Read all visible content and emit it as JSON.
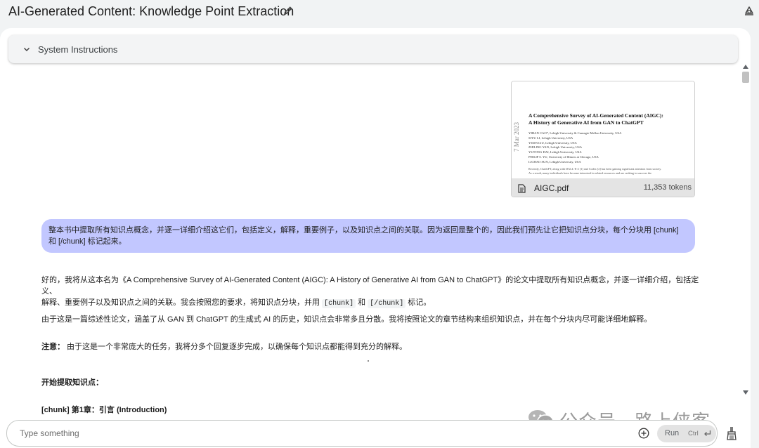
{
  "header": {
    "title": "AI-Generated Content: Knowledge Point Extraction"
  },
  "system_instructions": {
    "label": "System Instructions"
  },
  "attachment": {
    "file_name": "AIGC.pdf",
    "tokens": "11,353 tokens",
    "preview": {
      "title_line1": "A Comprehensive Survey of AI-Generated Content (AIGC):",
      "title_line2": "A History of Generative AI from GAN to ChatGPT",
      "authors": [
        "YIHAN CAO*, Lehigh University & Carnegie Mellon University, USA",
        "SIYU LI, Lehigh University, USA",
        "YIXIN LIU, Lehigh University, USA",
        "ZHILING YAN, Lehigh University, USA",
        "YUTONG DAI, Lehigh University, USA",
        "PHILIP S. YU, University of Illinois at Chicago, USA",
        "LICHAO SUN, Lehigh University, USA"
      ],
      "date": "7 Mar 2023",
      "abstract_line1": "Recently, ChatGPT, along with DALL-E-2 [1] and Codex [2] has been gaining significant attention from society.",
      "abstract_line2": "As a result, many individuals have become interested in related resources and are seeking to uncover the"
    }
  },
  "user_message": {
    "text": "整本书中提取所有知识点概念，并逐一详细介绍这它们，包括定义，解释，重要例子，以及知识点之间的关联。因为返回是整个的，因此我们预先让它把知识点分块，每个分块用 [chunk] 和 [/chunk] 标记起来。"
  },
  "response": {
    "p1_line1": "好的，我将从这本名为《A Comprehensive Survey of AI-Generated Content (AIGC): A History of Generative AI from GAN to ChatGPT》的论文中提取所有知识点概念，并逐一详细介绍，包括定义、",
    "p1_line2_a": "解释、重要例子以及知识点之间的关联。我会按照您的要求，将知识点分块，并用 ",
    "p1_code1": "[chunk]",
    "p1_line2_b": " 和 ",
    "p1_code2": "[/chunk]",
    "p1_line2_c": " 标记。",
    "p2": "由于这是一篇综述性论文，涵盖了从 GAN 到 ChatGPT 的生成式 AI 的历史，知识点会非常多且分散。我将按照论文的章节结构来组织知识点，并在每个分块内尽可能详细地解释。",
    "note_label": "注意：",
    "note_text": " 由于这是一个非常庞大的任务，我将分多个回复逐步完成，以确保每个知识点都能得到充分的解释。",
    "start_heading": "开始提取知识点：",
    "chunk_heading": "[chunk] 第1章：引言 (Introduction)"
  },
  "watermark": {
    "text": "公众号 · 路上侠客"
  },
  "composer": {
    "placeholder": "Type something",
    "run_label": "Run",
    "shortcut": "Ctrl"
  },
  "icons": {
    "edit": "pencil-icon",
    "top_right": "compare-icon",
    "chevron": "chevron-down-icon",
    "file": "document-icon",
    "add": "add-circle-icon",
    "enter": "enter-key-icon",
    "clear": "broom-icon"
  },
  "colors": {
    "user_bubble": "#c2c7ff",
    "background": "#f1f3f4",
    "panel": "#ffffff"
  }
}
